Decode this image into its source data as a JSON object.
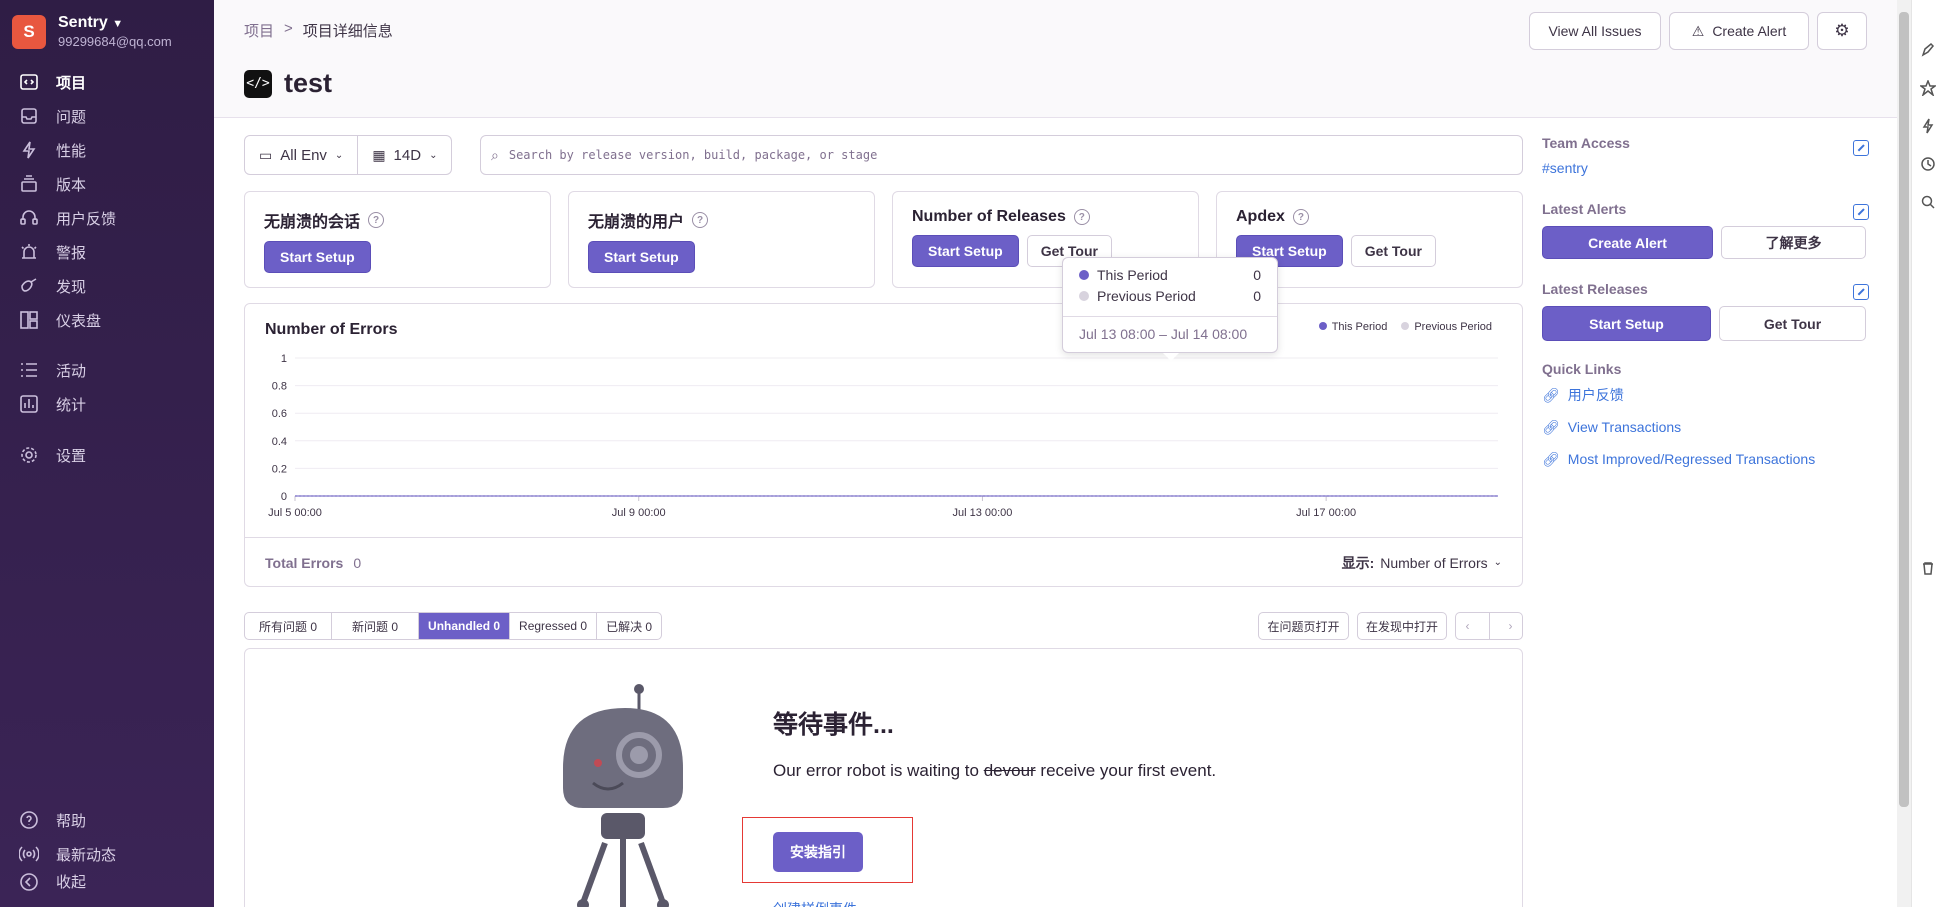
{
  "sidebar": {
    "org_initial": "S",
    "org_name": "Sentry",
    "org_email": "99299684@qq.com",
    "items": [
      {
        "label": "项目",
        "icon": "project-icon",
        "active": true
      },
      {
        "label": "问题",
        "icon": "issues-icon"
      },
      {
        "label": "性能",
        "icon": "performance-icon"
      },
      {
        "label": "版本",
        "icon": "releases-icon"
      },
      {
        "label": "用户反馈",
        "icon": "user-feedback-icon"
      },
      {
        "label": "警报",
        "icon": "alerts-icon"
      },
      {
        "label": "发现",
        "icon": "discover-icon"
      },
      {
        "label": "仪表盘",
        "icon": "dashboards-icon"
      },
      {
        "label": "活动",
        "icon": "activity-icon"
      },
      {
        "label": "统计",
        "icon": "stats-icon"
      },
      {
        "label": "设置",
        "icon": "settings-icon"
      }
    ],
    "bottom": [
      {
        "label": "帮助",
        "icon": "help-icon"
      },
      {
        "label": "最新动态",
        "icon": "broadcast-icon"
      },
      {
        "label": "收起",
        "icon": "collapse-icon"
      }
    ]
  },
  "header": {
    "breadcrumb_root": "项目",
    "breadcrumb_sep": ">",
    "breadcrumb_current": "项目详细信息",
    "project_icon": "</>",
    "project_name": "test",
    "view_all_issues": "View All Issues",
    "create_alert": "Create Alert"
  },
  "filters": {
    "env": "All Env",
    "period": "14D",
    "search_placeholder": "Search by release version, build, package, or stage"
  },
  "cards": [
    {
      "title": "无崩溃的会话",
      "primary": "Start Setup"
    },
    {
      "title": "无崩溃的用户",
      "primary": "Start Setup"
    },
    {
      "title": "Number of Releases",
      "primary": "Start Setup",
      "secondary": "Get Tour"
    },
    {
      "title": "Apdex",
      "primary": "Start Setup",
      "secondary": "Get Tour"
    }
  ],
  "chart": {
    "total_label": "Total Errors",
    "total_value": "0",
    "display_label": "显示:",
    "display_value": "Number of Errors"
  },
  "chart_data": {
    "type": "line",
    "title": "Number of Errors",
    "series": [
      {
        "name": "This Period",
        "color": "#6c5fc7",
        "values": [
          0,
          0,
          0,
          0,
          0,
          0,
          0,
          0,
          0,
          0,
          0,
          0,
          0,
          0,
          0
        ]
      },
      {
        "name": "Previous Period",
        "color": "#d8d3de",
        "values": [
          0,
          0,
          0,
          0,
          0,
          0,
          0,
          0,
          0,
          0,
          0,
          0,
          0,
          0,
          0
        ]
      }
    ],
    "x_ticks": [
      "Jul 5 00:00",
      "Jul 9 00:00",
      "Jul 13 00:00",
      "Jul 17 00:00"
    ],
    "y_ticks": [
      "1",
      "0.8",
      "0.6",
      "0.4",
      "0.2",
      "0"
    ],
    "ylim": [
      0,
      1
    ],
    "grid": true,
    "legend": "top-right"
  },
  "tooltip": {
    "this_period": "This Period",
    "this_value": "0",
    "prev_period": "Previous Period",
    "prev_value": "0",
    "range": "Jul 13 08:00 – Jul 14 08:00"
  },
  "issue_tabs": [
    {
      "label": "所有问题 0"
    },
    {
      "label": "新问题 0"
    },
    {
      "label": "Unhandled 0",
      "active": true
    },
    {
      "label": "Regressed 0"
    },
    {
      "label": "已解决 0"
    }
  ],
  "issue_actions": {
    "open_issues": "在问题页打开",
    "open_discover": "在发现中打开"
  },
  "empty_state": {
    "title": "等待事件...",
    "desc_before": "Our error robot is waiting to ",
    "desc_struck": "devour",
    "desc_after": " receive your first event.",
    "install_button": "安装指引",
    "create_sample": "创建样例事件"
  },
  "right_panel": {
    "team_access_title": "Team Access",
    "team": "#sentry",
    "alerts_title": "Latest Alerts",
    "alerts_create": "Create Alert",
    "alerts_more": "了解更多",
    "releases_title": "Latest Releases",
    "releases_setup": "Start Setup",
    "releases_tour": "Get Tour",
    "quick_links_title": "Quick Links",
    "quick_links": [
      "用户反馈",
      "View Transactions",
      "Most Improved/Regressed Transactions"
    ]
  }
}
